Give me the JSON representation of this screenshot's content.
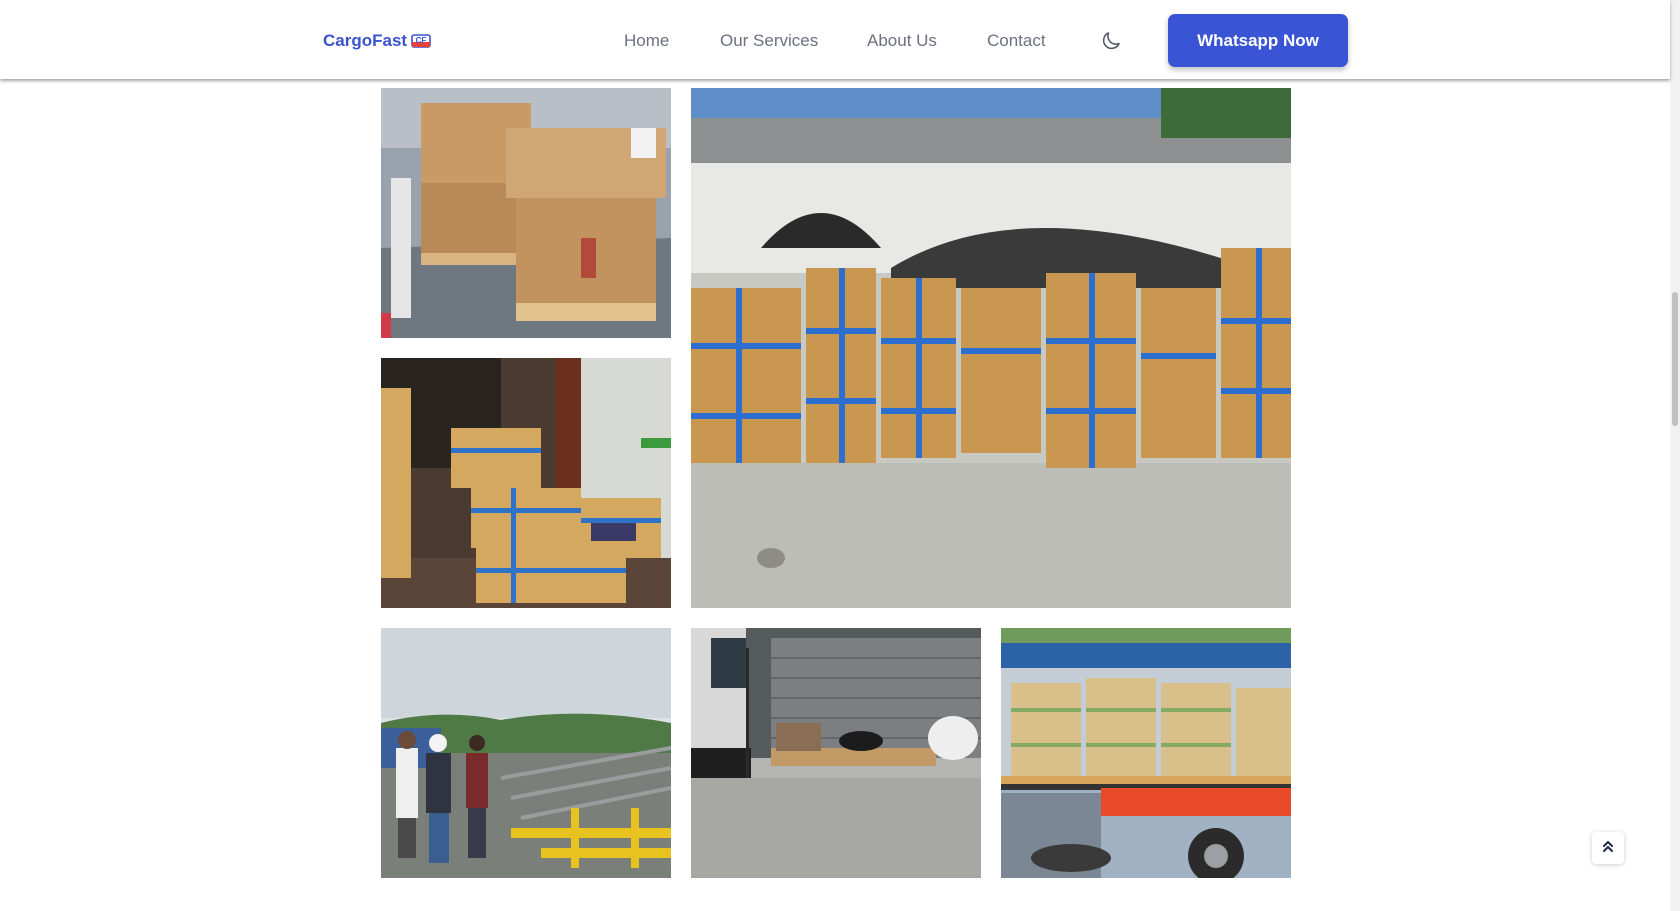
{
  "header": {
    "logo_text": "CargoFast",
    "logo_badge": "CF",
    "nav": [
      {
        "label": "Home"
      },
      {
        "label": "Our Services"
      },
      {
        "label": "About Us"
      },
      {
        "label": "Contact"
      }
    ],
    "theme_toggle_icon": "moon-icon",
    "cta_label": "Whatsapp Now"
  },
  "gallery": {
    "photos": [
      {
        "subject": "cardboard boxes on pallets in truck"
      },
      {
        "subject": "stacks of taped cargo boxes in front of warehouse"
      },
      {
        "subject": "taped boxes stacked indoors"
      },
      {
        "subject": "workers inspecting steel frames on site"
      },
      {
        "subject": "pallets and materials in loading bay"
      },
      {
        "subject": "wrapped pallets loaded on truck"
      }
    ]
  },
  "back_to_top_icon": "chevrons-up-icon",
  "colors": {
    "brand": "#3a53cf",
    "cta_bg": "#3a54d6",
    "nav_text": "#6b7180"
  }
}
